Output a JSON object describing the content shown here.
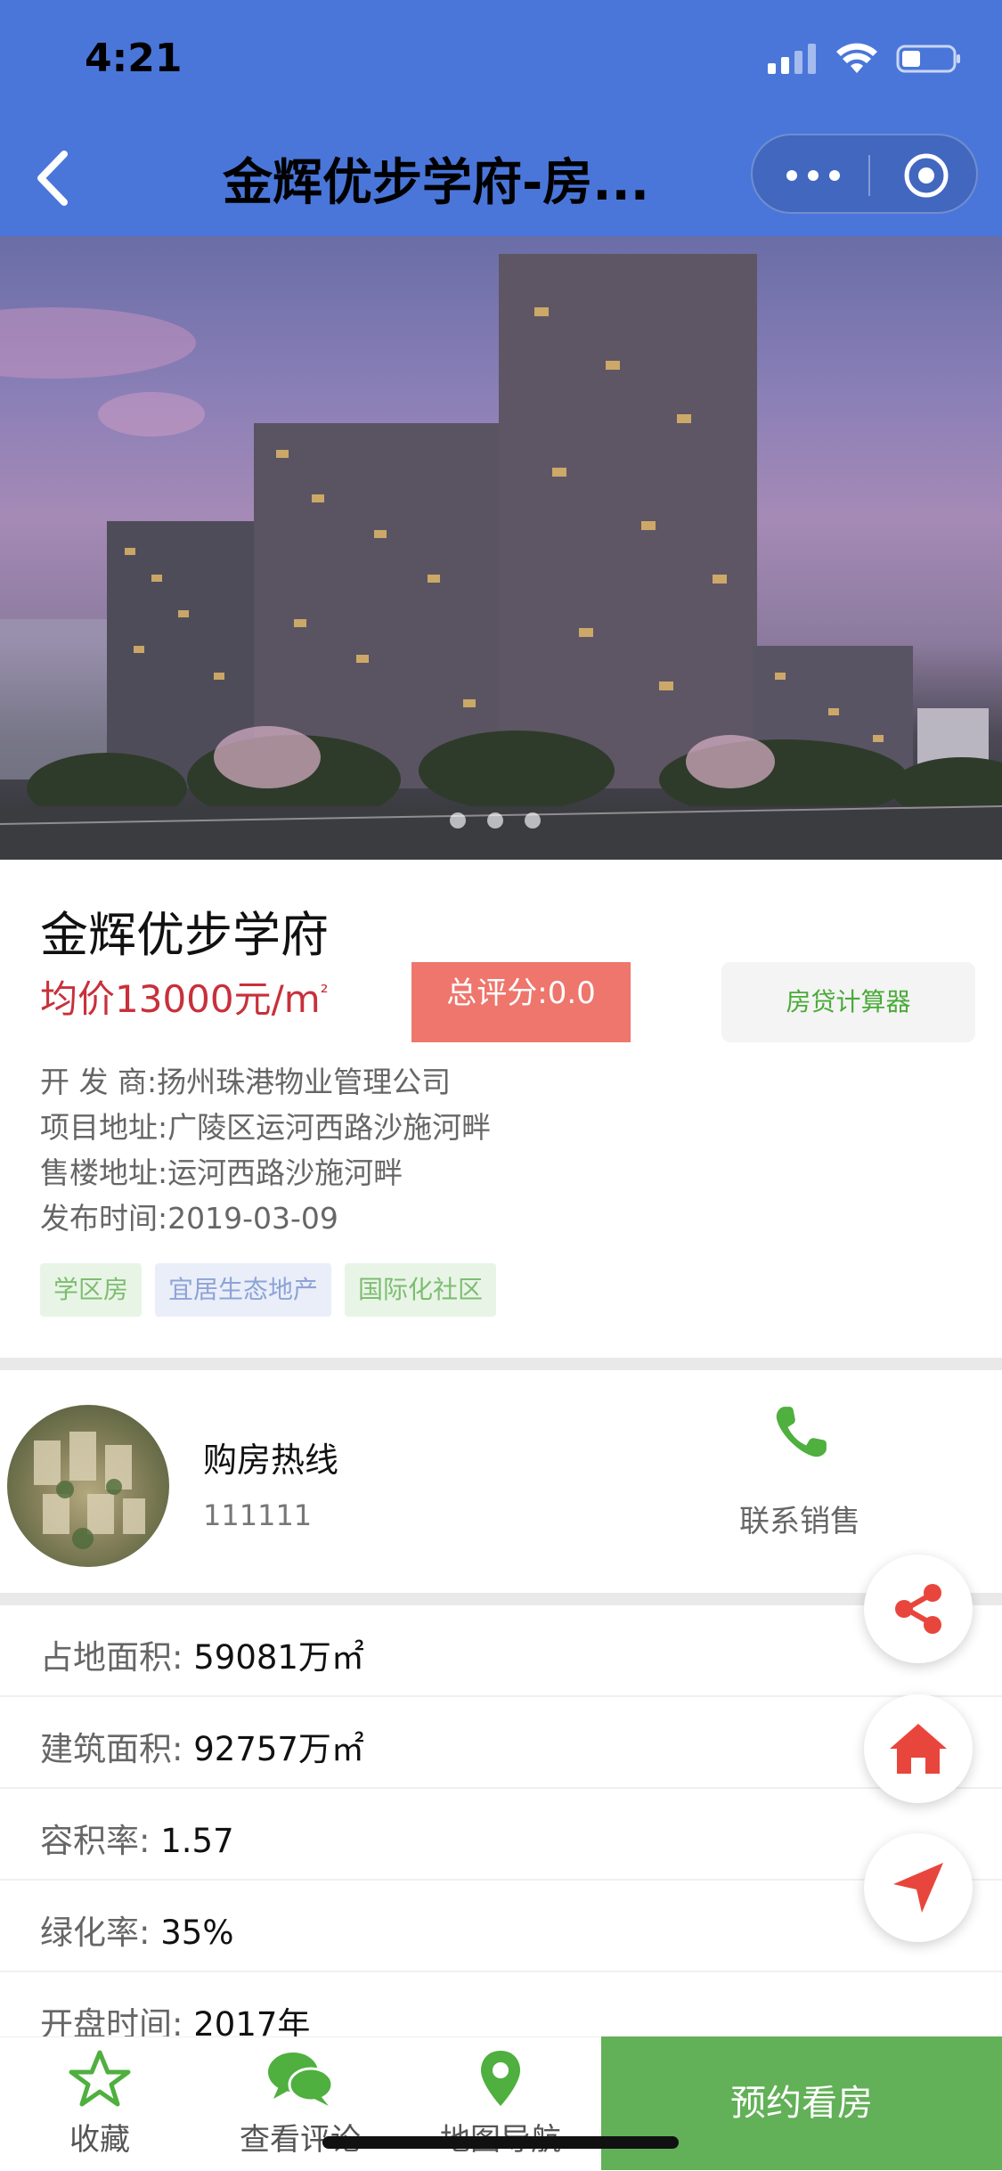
{
  "status_bar": {
    "time": "4:21"
  },
  "nav": {
    "title": "金辉优步学府-房..."
  },
  "carousel": {
    "dot_count": 3
  },
  "property": {
    "name": "金辉优步学府",
    "price_text": "均价13000元/m",
    "price_sup": "²",
    "score": "总评分:0.0",
    "calculator_label": "房贷计算器",
    "developer": "开 发 商:扬州珠港物业管理公司",
    "address": "项目地址:广陵区运河西路沙施河畔",
    "sales_address": "售楼地址:运河西路沙施河畔",
    "publish_date": "发布时间:2019-03-09",
    "tags": [
      "学区房",
      "宜居生态地产",
      "国际化社区"
    ]
  },
  "hotline": {
    "title": "购房热线",
    "number": "111111",
    "contact_label": "联系销售"
  },
  "specs": [
    {
      "label": "占地面积:",
      "value": "59081万㎡"
    },
    {
      "label": "建筑面积:",
      "value": "92757万㎡"
    },
    {
      "label": "容积率:",
      "value": "1.57"
    },
    {
      "label": "绿化率:",
      "value": "35%"
    },
    {
      "label": "开盘时间:",
      "value": "2017年"
    }
  ],
  "bottom_bar": {
    "favorite": "收藏",
    "reviews": "查看评论",
    "map": "地图导航",
    "book": "预约看房"
  },
  "colors": {
    "nav_bg": "#4a76da",
    "price": "#c8303b",
    "score_bg": "#ee766c",
    "accent_green": "#62b057",
    "fab_icon": "#e8463c"
  }
}
